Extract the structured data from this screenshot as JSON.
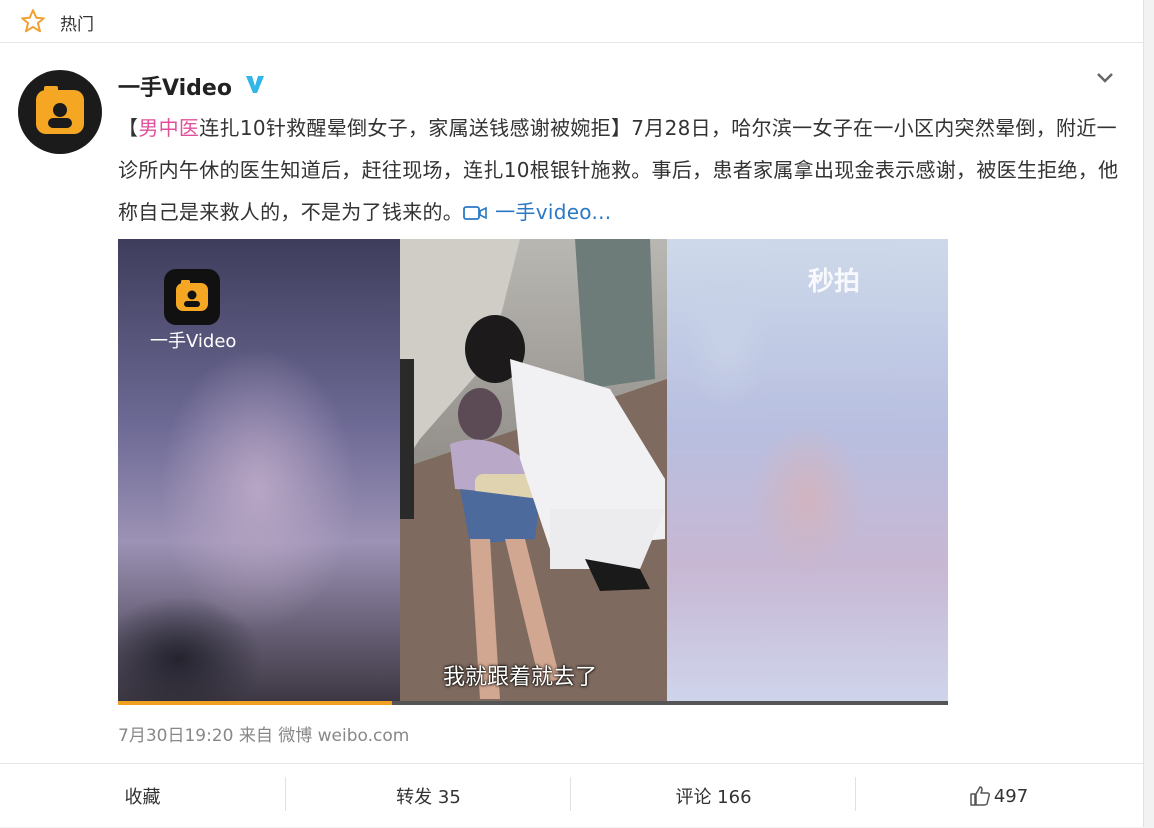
{
  "topbar": {
    "tab_label": "热门"
  },
  "post": {
    "username": "一手Video",
    "text_open": "【",
    "tag": "男中医",
    "text_body": "连扎10针救醒晕倒女子，家属送钱感谢被婉拒】7月28日，哈尔滨一女子在一小区内突然晕倒，附近一诊所内午休的医生知道后，赶往现场，连扎10根银针施救。事后，患者家属拿出现金表示感谢，被医生拒绝，他称自己是来救人的，不是为了钱来的。",
    "link_text": "一手video..."
  },
  "video": {
    "logo_text": "一手Video",
    "watermark": "秒拍",
    "subtitle": "我就跟着就去了",
    "progress": 0.33
  },
  "meta": {
    "time_source": "7月30日19:20 来自 微博 weibo.com"
  },
  "actions": {
    "favorite": "收藏",
    "repost": "转发 35",
    "comment": "评论 166",
    "like": "497"
  },
  "colors": {
    "tag": "#e0509b",
    "link": "#2b78c5",
    "progress": "#f0a020"
  }
}
